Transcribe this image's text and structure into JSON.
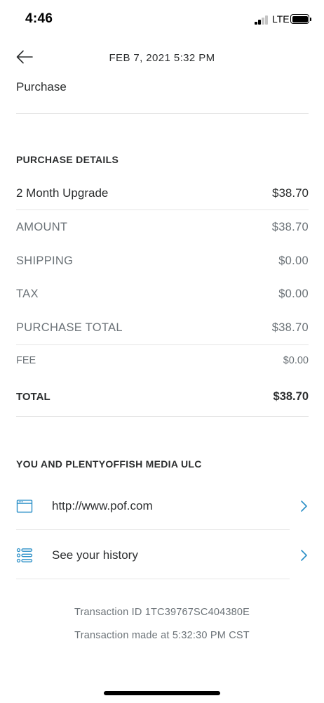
{
  "status_bar": {
    "time": "4:46",
    "network": "LTE"
  },
  "header": {
    "datetime": "FEB 7, 2021  5:32 PM",
    "type": "Purchase"
  },
  "purchase_details": {
    "title": "PURCHASE DETAILS",
    "item": {
      "label": "2 Month Upgrade",
      "value": "$38.70"
    },
    "amount": {
      "label": "AMOUNT",
      "value": "$38.70"
    },
    "shipping": {
      "label": "SHIPPING",
      "value": "$0.00"
    },
    "tax": {
      "label": "TAX",
      "value": "$0.00"
    },
    "purchase_total": {
      "label": "PURCHASE TOTAL",
      "value": "$38.70"
    },
    "fee": {
      "label": "FEE",
      "value": "$0.00"
    },
    "total": {
      "label": "TOTAL",
      "value": "$38.70"
    }
  },
  "merchant": {
    "title": "YOU AND PLENTYOFFISH MEDIA ULC",
    "website": "http://www.pof.com",
    "history": "See your history"
  },
  "footer": {
    "transaction_id": "Transaction ID 1TC39767SC404380E",
    "transaction_time": "Transaction made at 5:32:30 PM CST"
  },
  "colors": {
    "icon_blue": "#2a8fc7",
    "text": "#2c2e2f",
    "muted": "#6c7378",
    "divider": "#e6e6e6"
  }
}
